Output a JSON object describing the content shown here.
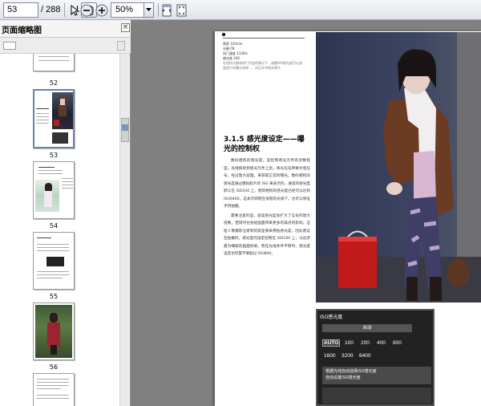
{
  "toolbar": {
    "page_input": "53",
    "page_total": "/ 288",
    "zoom_value": "50%"
  },
  "thumbnails_panel": {
    "title": "页面缩略图",
    "close_glyph": "×",
    "pages": [
      {
        "label": "52"
      },
      {
        "label": "53"
      },
      {
        "label": "54"
      },
      {
        "label": "55"
      },
      {
        "label": "56"
      }
    ]
  },
  "page": {
    "meta_lines": [
      "焦距  105mm",
      "光圈  f/8",
      "快门速度  1/160s",
      "感光度  200"
    ],
    "meta_note": "在保持光圈和快门不变的情况下，调整ISO感光度可以改变照片的曝光效果……详见本书相关章节",
    "section_title": "3.1.5   感光度设定——曝光的控制权",
    "paragraphs": [
      "数码相机的感光度，是控制感光元件的灵敏程度。光线照射到感光元件上后，将光信号转换为电信号，经过放大处理，来获取正常的曝光。数码相机的感光度通过模拟胶片的 ISO 来表示的，通常的感光度默认在 ISO100 上，而新相机的感光度已经可以达到 ISO6400，这表示即使在很暗的光线下，也可以保证手持拍摄。",
      "需要注意的是，提高感光度会扩大了信号的放大倍数，但同时也会给画面带来更多的噪点的影响。这给人像摄影注意到的就是要采用低感光度，因此建议在拍摄时，感光度的设定控制在 ISO100 上，以追求最为细腻的画面效果。而在光线条件不够时，感光度设定也尽量不要超过 ISO800。"
    ],
    "lcd": {
      "title": "ISO感光度",
      "auto_bar": "自动",
      "options_row1": [
        "AUTO",
        "100",
        "200",
        "400",
        "800"
      ],
      "options_row2": [
        "1600",
        "3200",
        "6400"
      ],
      "note_lines": [
        "根据光线自动选择ISO感光度",
        "自动设置ISO感光度"
      ]
    }
  }
}
